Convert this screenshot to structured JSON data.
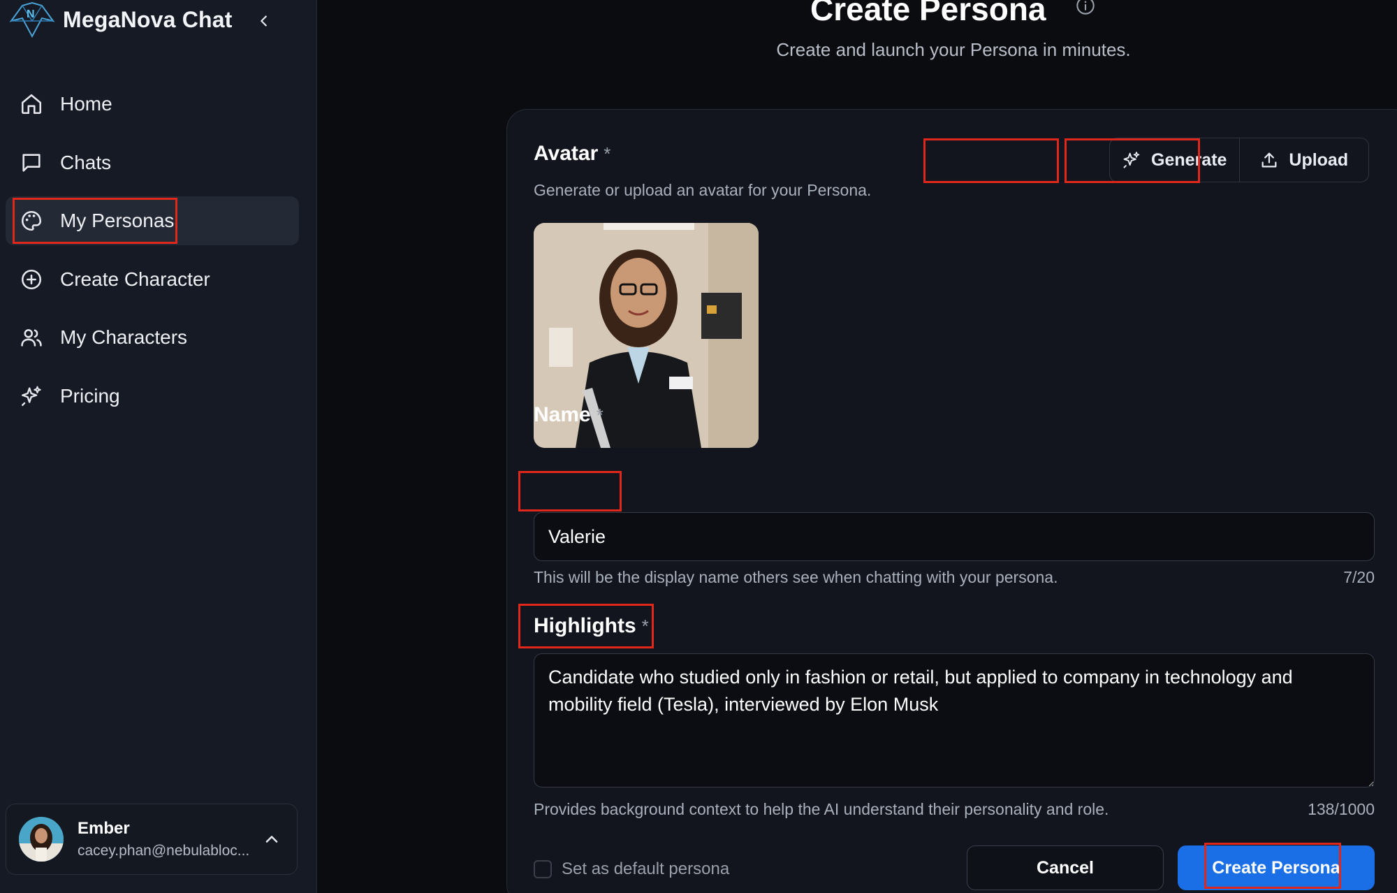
{
  "brand": {
    "name": "MegaNova Chat"
  },
  "sidebar": {
    "items": [
      {
        "label": "Home",
        "icon": "home-icon"
      },
      {
        "label": "Chats",
        "icon": "chat-bubble-icon"
      },
      {
        "label": "My Personas",
        "icon": "palette-icon",
        "active": true
      },
      {
        "label": "Create Character",
        "icon": "plus-circle-icon"
      },
      {
        "label": "My Characters",
        "icon": "users-icon"
      },
      {
        "label": "Pricing",
        "icon": "sparkles-icon"
      }
    ]
  },
  "user": {
    "name": "Ember",
    "email": "cacey.phan@nebulabloc..."
  },
  "page": {
    "title": "Create Persona",
    "subtitle": "Create and launch your Persona in minutes."
  },
  "avatar": {
    "label": "Avatar",
    "required_mark": "*",
    "helper": "Generate or upload an avatar for your Persona.",
    "generate_label": "Generate",
    "upload_label": "Upload"
  },
  "name": {
    "label": "Name",
    "required_mark": "*",
    "value": "Valerie",
    "helper": "This will be the display name others see when chatting with your persona.",
    "counter": "7/20"
  },
  "highlights": {
    "label": "Highlights",
    "required_mark": "*",
    "value": "Candidate who studied only in fashion or retail, but applied to company in technology and mobility field (Tesla), interviewed by Elon Musk",
    "helper": "Provides background context to help the AI understand their personality and role.",
    "counter": "138/1000"
  },
  "footer": {
    "default_label": "Set as default persona",
    "cancel_label": "Cancel",
    "create_label": "Create Persona"
  },
  "colors": {
    "accent": "#1a6fe6",
    "annotation": "#e0271c",
    "sidebar_bg": "#161a24",
    "page_bg": "#0b0c10"
  }
}
